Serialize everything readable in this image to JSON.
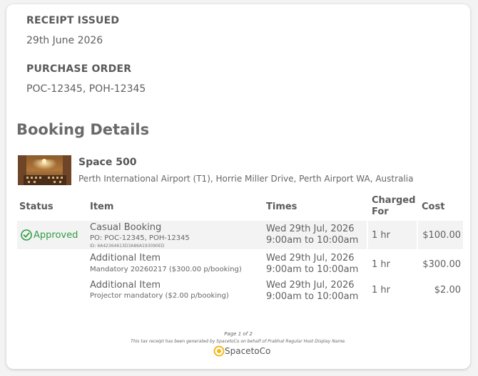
{
  "receipt": {
    "issued_label": "RECEIPT ISSUED",
    "issued_value": "29th June 2026",
    "po_label": "PURCHASE ORDER",
    "po_value": "POC-12345, POH-12345"
  },
  "booking": {
    "section_title": "Booking Details",
    "space_name": "Space 500",
    "space_address": "Perth International Airport (T1), Horrie Miller Drive, Perth Airport WA, Australia"
  },
  "table": {
    "headers": {
      "status": "Status",
      "item": "Item",
      "times": "Times",
      "charged_for": "Charged For",
      "cost": "Cost"
    },
    "rows": [
      {
        "status": "Approved",
        "item_title": "Casual Booking",
        "item_sub": "PO: POC-12345, POH-12345",
        "item_id": "ID: 6A42364613D3A86A193090ED",
        "time_date": "Wed 29th Jul, 2026",
        "time_range": "9:00am to 10:00am",
        "charged": "1 hr",
        "cost": "$100.00"
      },
      {
        "item_title": "Additional Item",
        "item_sub": "Mandatory 20260217 ($300.00 p/booking)",
        "time_date": "Wed 29th Jul, 2026",
        "time_range": "9:00am to 10:00am",
        "charged": "1 hr",
        "cost": "$300.00"
      },
      {
        "item_title": "Additional Item",
        "item_sub": "Projector mandatory ($2.00 p/booking)",
        "time_date": "Wed 29th Jul, 2026",
        "time_range": "9:00am to 10:00am",
        "charged": "1 hr",
        "cost": "$2.00"
      }
    ]
  },
  "footer": {
    "page": "Page 1 of 2",
    "note": "This tax receipt has been generated by SpacetoCo on behalf of Prabhat Regular Host Display Name.",
    "brand": "SpacetoCo"
  },
  "colors": {
    "approved": "#2e9e44",
    "logo_ring": "#f2b81b"
  }
}
